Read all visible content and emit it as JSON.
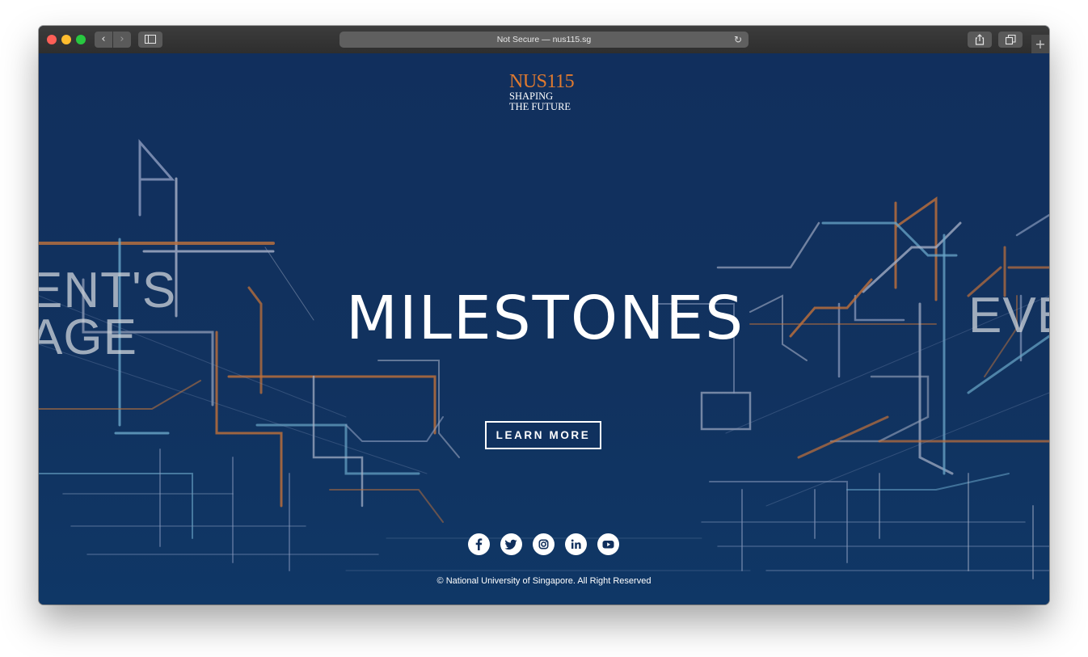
{
  "browser": {
    "address": "Not Secure — nus115.sg",
    "reload_icon": "reload-icon",
    "new_tab_glyph": "+"
  },
  "logo": {
    "main": "NUS115",
    "line1": "SHAPING",
    "line2": "THE FUTURE"
  },
  "slides": {
    "prev_line1": "ENT'S",
    "prev_line2": "AGE",
    "current": "MILESTONES",
    "next": "EVE"
  },
  "cta": {
    "label": "LEARN MORE"
  },
  "social": [
    "facebook-icon",
    "twitter-icon",
    "instagram-icon",
    "linkedin-icon",
    "youtube-icon"
  ],
  "footer": {
    "copyright": "© National University of Singapore. All Right Reserved"
  },
  "colors": {
    "background": "#102f5c",
    "accent_orange": "#e07a2f",
    "line_blue": "#6aa6c8",
    "line_orange": "#c0713a"
  }
}
